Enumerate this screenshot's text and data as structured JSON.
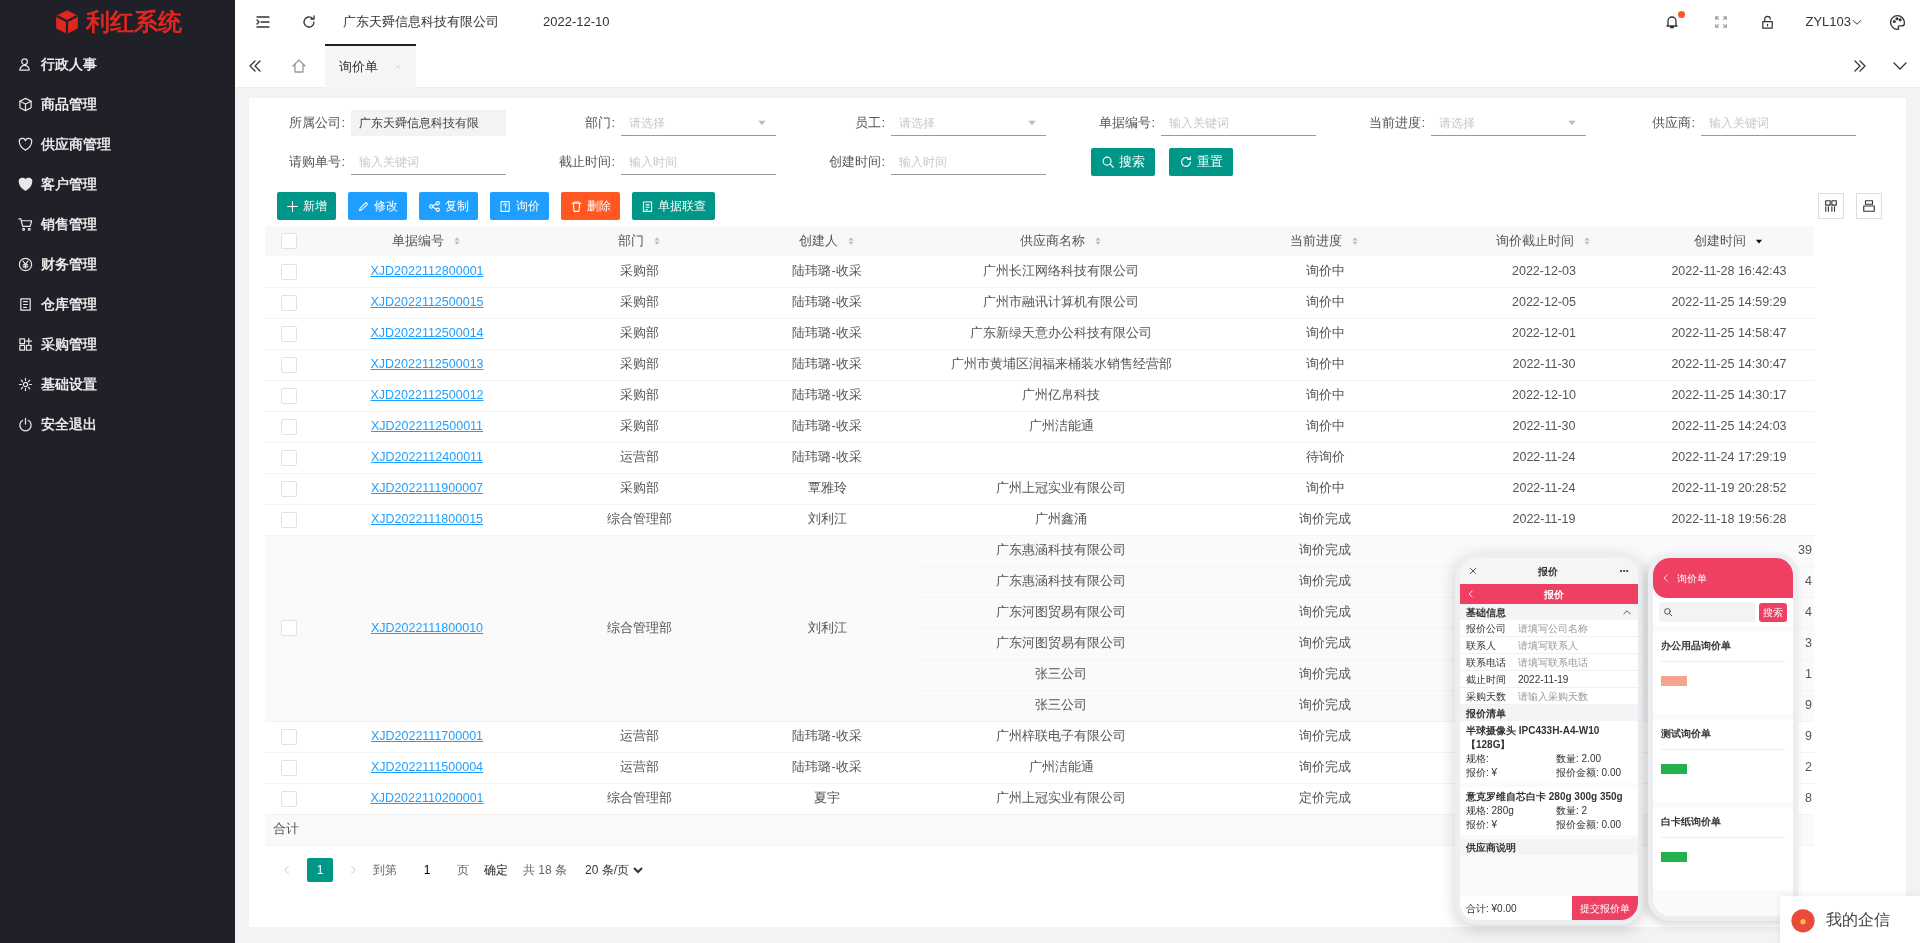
{
  "logo": {
    "text": "利红系统"
  },
  "sidebar": {
    "items": [
      {
        "label": "行政人事"
      },
      {
        "label": "商品管理"
      },
      {
        "label": "供应商管理"
      },
      {
        "label": "客户管理"
      },
      {
        "label": "销售管理"
      },
      {
        "label": "财务管理"
      },
      {
        "label": "仓库管理"
      },
      {
        "label": "采购管理"
      },
      {
        "label": "基础设置"
      },
      {
        "label": "安全退出"
      }
    ]
  },
  "topbar": {
    "company": "广东天舜信息科技有限公司",
    "date": "2022-12-10",
    "user": "ZYL103",
    "unread": true
  },
  "tabs": [
    {
      "label": "询价单",
      "selected": true
    }
  ],
  "filters": [
    {
      "label": "所属公司:",
      "kind": "readonly",
      "value": "广东天舜信息科技有限"
    },
    {
      "label": "部门:",
      "kind": "select",
      "placeholder": "请选择"
    },
    {
      "label": "员工:",
      "kind": "select",
      "placeholder": "请选择"
    },
    {
      "label": "单据编号:",
      "kind": "text",
      "placeholder": "输入关键词"
    },
    {
      "label": "当前进度:",
      "kind": "select",
      "placeholder": "请选择"
    },
    {
      "label": "供应商:",
      "kind": "text",
      "placeholder": "输入关键词"
    },
    {
      "label": "请购单号:",
      "kind": "text",
      "placeholder": "输入关键词"
    },
    {
      "label": "截止时间:",
      "kind": "text",
      "placeholder": "输入时间"
    },
    {
      "label": "创建时间:",
      "kind": "text",
      "placeholder": "输入时间"
    }
  ],
  "filter_buttons": [
    {
      "label": "搜索",
      "kind": "search"
    },
    {
      "label": "重置",
      "kind": "reset"
    }
  ],
  "toolbar": [
    {
      "label": "新增",
      "kind": "add"
    },
    {
      "label": "修改",
      "kind": "edit"
    },
    {
      "label": "复制",
      "kind": "copy"
    },
    {
      "label": "询价",
      "kind": "inquiry"
    },
    {
      "label": "删除",
      "kind": "delete"
    },
    {
      "label": "单据联查",
      "kind": "linked"
    }
  ],
  "table": {
    "columns": [
      {
        "kind": "checkbox",
        "checked": false
      },
      {
        "label": "单据编号",
        "sorted": false
      },
      {
        "label": "部门",
        "sorted": false
      },
      {
        "label": "创建人",
        "sorted": false
      },
      {
        "label": "供应商名称",
        "sorted": false
      },
      {
        "label": "当前进度",
        "sorted": false
      },
      {
        "label": "询价截止时间",
        "sorted": false
      },
      {
        "label": "创建时间",
        "sorted": true
      }
    ],
    "rows": [
      {
        "checked": false,
        "number": "XJD2022112800001",
        "dept": "采购部",
        "creator": "陆玮璐-收采",
        "lines": [
          {
            "supplier": "广州长江网络科技有限公司",
            "progress": "询价中",
            "deadline": "2022-12-03",
            "created": "2022-11-28 16:42:43"
          }
        ]
      },
      {
        "checked": false,
        "number": "XJD2022112500015",
        "dept": "采购部",
        "creator": "陆玮璐-收采",
        "lines": [
          {
            "supplier": "广州市融讯计算机有限公司",
            "progress": "询价中",
            "deadline": "2022-12-05",
            "created": "2022-11-25 14:59:29"
          }
        ]
      },
      {
        "checked": false,
        "number": "XJD2022112500014",
        "dept": "采购部",
        "creator": "陆玮璐-收采",
        "lines": [
          {
            "supplier": "广东新绿天意办公科技有限公司",
            "progress": "询价中",
            "deadline": "2022-12-01",
            "created": "2022-11-25 14:58:47"
          }
        ]
      },
      {
        "checked": false,
        "number": "XJD2022112500013",
        "dept": "采购部",
        "creator": "陆玮璐-收采",
        "lines": [
          {
            "supplier": "广州市黄埔区润福来桶装水销售经营部",
            "progress": "询价中",
            "deadline": "2022-11-30",
            "created": "2022-11-25 14:30:47"
          }
        ]
      },
      {
        "checked": false,
        "number": "XJD2022112500012",
        "dept": "采购部",
        "creator": "陆玮璐-收采",
        "lines": [
          {
            "supplier": "广州亿帛科技",
            "progress": "询价中",
            "deadline": "2022-12-10",
            "created": "2022-11-25 14:30:17"
          }
        ]
      },
      {
        "checked": false,
        "number": "XJD2022112500011",
        "dept": "采购部",
        "creator": "陆玮璐-收采",
        "lines": [
          {
            "supplier": "广州洁能通",
            "progress": "询价中",
            "deadline": "2022-11-30",
            "created": "2022-11-25 14:24:03"
          }
        ]
      },
      {
        "checked": false,
        "number": "XJD2022112400011",
        "dept": "运营部",
        "creator": "陆玮璐-收采",
        "lines": [
          {
            "progress": "待询价",
            "deadline": "2022-11-24",
            "created": "2022-11-24 17:29:19"
          }
        ]
      },
      {
        "checked": false,
        "number": "XJD2022111900007",
        "dept": "采购部",
        "creator": "覃雅玲",
        "lines": [
          {
            "supplier": "广州上冠实业有限公司",
            "progress": "询价中",
            "deadline": "2022-11-24",
            "created": "2022-11-19 20:28:52"
          }
        ]
      },
      {
        "checked": false,
        "number": "XJD2022111800015",
        "dept": "综合管理部",
        "creator": "刘利江",
        "lines": [
          {
            "supplier": "广州鑫涌",
            "progress": "询价完成",
            "deadline": "2022-11-19",
            "created": "2022-11-18 19:56:28"
          }
        ]
      },
      {
        "checked": false,
        "number": "XJD2022111800010",
        "dept": "综合管理部",
        "creator": "刘利江",
        "lines": [
          {
            "supplier": "广东惠涵科技有限公司",
            "progress": "询价完成",
            "created": "39"
          },
          {
            "supplier": "广东惠涵科技有限公司",
            "progress": "询价完成",
            "created": "4"
          },
          {
            "supplier": "广东河图贸易有限公司",
            "progress": "询价完成",
            "created": "4"
          },
          {
            "supplier": "广东河图贸易有限公司",
            "progress": "询价完成",
            "created": "3"
          },
          {
            "supplier": "张三公司",
            "progress": "询价完成",
            "created": "1"
          },
          {
            "supplier": "张三公司",
            "progress": "询价完成",
            "created": "9"
          }
        ]
      },
      {
        "checked": false,
        "number": "XJD2022111700001",
        "dept": "运营部",
        "creator": "陆玮璐-收采",
        "lines": [
          {
            "supplier": "广州梓联电子有限公司",
            "progress": "询价完成",
            "created": "9"
          }
        ]
      },
      {
        "checked": false,
        "number": "XJD2022111500004",
        "dept": "运营部",
        "creator": "陆玮璐-收采",
        "lines": [
          {
            "supplier": "广州洁能通",
            "progress": "询价完成",
            "created": "2"
          }
        ]
      },
      {
        "checked": false,
        "number": "XJD2022110200001",
        "dept": "综合管理部",
        "creator": "夏宇",
        "lines": [
          {
            "supplier": "广州上冠实业有限公司",
            "progress": "定价完成",
            "created": "8"
          }
        ]
      }
    ],
    "footer": "合计"
  },
  "pagination": {
    "pages": [
      {
        "label": "1",
        "selected": true
      }
    ],
    "goto_label": "到第",
    "goto_value": "1",
    "page_label": "页",
    "confirm": "确定",
    "total": "共 18 条",
    "page_size": "20 条/页"
  },
  "quote_phone": {
    "nav_title": "报价",
    "header": "报价",
    "basic_title": "基础信息",
    "fields": [
      {
        "label": "报价公司",
        "placeholder": "请填写公司名称"
      },
      {
        "label": "联系人",
        "placeholder": "请填写联系人"
      },
      {
        "label": "联系电话",
        "placeholder": "请填写联系电话"
      },
      {
        "label": "截止时间",
        "value": "2022-11-19"
      },
      {
        "label": "采购天数",
        "placeholder": "请输入采购天数"
      }
    ],
    "list_title": "报价清单",
    "items": [
      {
        "name": "半球摄像头 IPC433H-A4-W10【128G】",
        "spec": "规格:",
        "qty": "数量: 2.00",
        "price": "报价: ¥",
        "amount": "报价金额: 0.00"
      },
      {
        "name": "意克罗维自芯白卡 280g 300g 350g",
        "spec": "规格: 280g",
        "qty": "数量: 2",
        "price": "报价: ¥",
        "amount": "报价金额: 0.00"
      }
    ],
    "note_title": "供应商说明",
    "total": "合计: ¥0.00",
    "submit": "提交报价单"
  },
  "list_phone": {
    "header": "询价单",
    "search_button": "搜索",
    "cards": [
      {
        "title": "办公用品询价单",
        "color": "#f7a48f"
      },
      {
        "title": "测试询价单",
        "color": "#22b14c"
      },
      {
        "title": "白卡纸询价单",
        "color": "#22b14c"
      }
    ]
  },
  "chat_widget": {
    "label": "我的企信"
  }
}
